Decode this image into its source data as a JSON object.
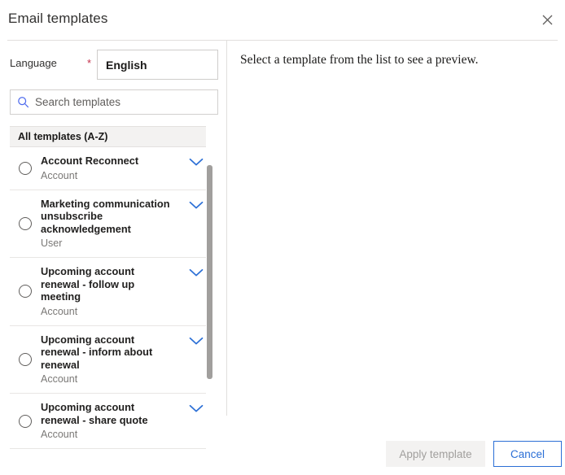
{
  "dialog": {
    "title": "Email templates",
    "close_icon": "close-icon"
  },
  "language": {
    "label": "Language",
    "required_marker": "*",
    "value": "English"
  },
  "search": {
    "placeholder": "Search templates",
    "icon": "search-icon",
    "value": ""
  },
  "list": {
    "header": "All templates (A-Z)",
    "items": [
      {
        "name": "Account Reconnect",
        "entity": "Account",
        "selected": false
      },
      {
        "name": "Marketing communication unsubscribe acknowledgement",
        "entity": "User",
        "selected": false
      },
      {
        "name": "Upcoming account renewal - follow up meeting",
        "entity": "Account",
        "selected": false
      },
      {
        "name": "Upcoming account renewal - inform about renewal",
        "entity": "Account",
        "selected": false
      },
      {
        "name": "Upcoming account renewal - share quote",
        "entity": "Account",
        "selected": false
      }
    ]
  },
  "preview": {
    "empty_message": "Select a template from the list to see a preview."
  },
  "footer": {
    "apply_label": "Apply template",
    "apply_disabled": true,
    "cancel_label": "Cancel"
  },
  "colors": {
    "accent": "#2b6fd6",
    "required": "#c4314b",
    "divider": "#e1dfdd",
    "list_header_bg": "#f3f2f1",
    "disabled_bg": "#f3f2f1",
    "disabled_text": "#a19f9d",
    "scrollbar_thumb": "#a19f9d"
  }
}
